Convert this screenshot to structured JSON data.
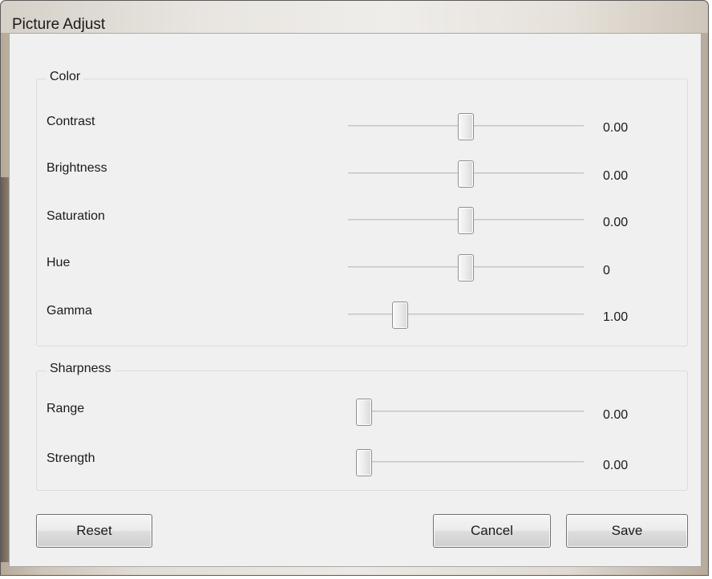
{
  "window": {
    "title": "Picture Adjust"
  },
  "color_group": {
    "legend": "Color",
    "rows": [
      {
        "label": "Contrast",
        "value": "0.00",
        "slider_fraction": 0.5
      },
      {
        "label": "Brightness",
        "value": "0.00",
        "slider_fraction": 0.5
      },
      {
        "label": "Saturation",
        "value": "0.00",
        "slider_fraction": 0.5
      },
      {
        "label": "Hue",
        "value": "0",
        "slider_fraction": 0.5
      },
      {
        "label": "Gamma",
        "value": "1.00",
        "slider_fraction": 0.2
      }
    ]
  },
  "sharpness_group": {
    "legend": "Sharpness",
    "rows": [
      {
        "label": "Range",
        "value": "0.00",
        "slider_fraction": 0.0
      },
      {
        "label": "Strength",
        "value": "0.00",
        "slider_fraction": 0.0
      }
    ]
  },
  "buttons": {
    "reset": "Reset",
    "cancel": "Cancel",
    "save": "Save"
  }
}
